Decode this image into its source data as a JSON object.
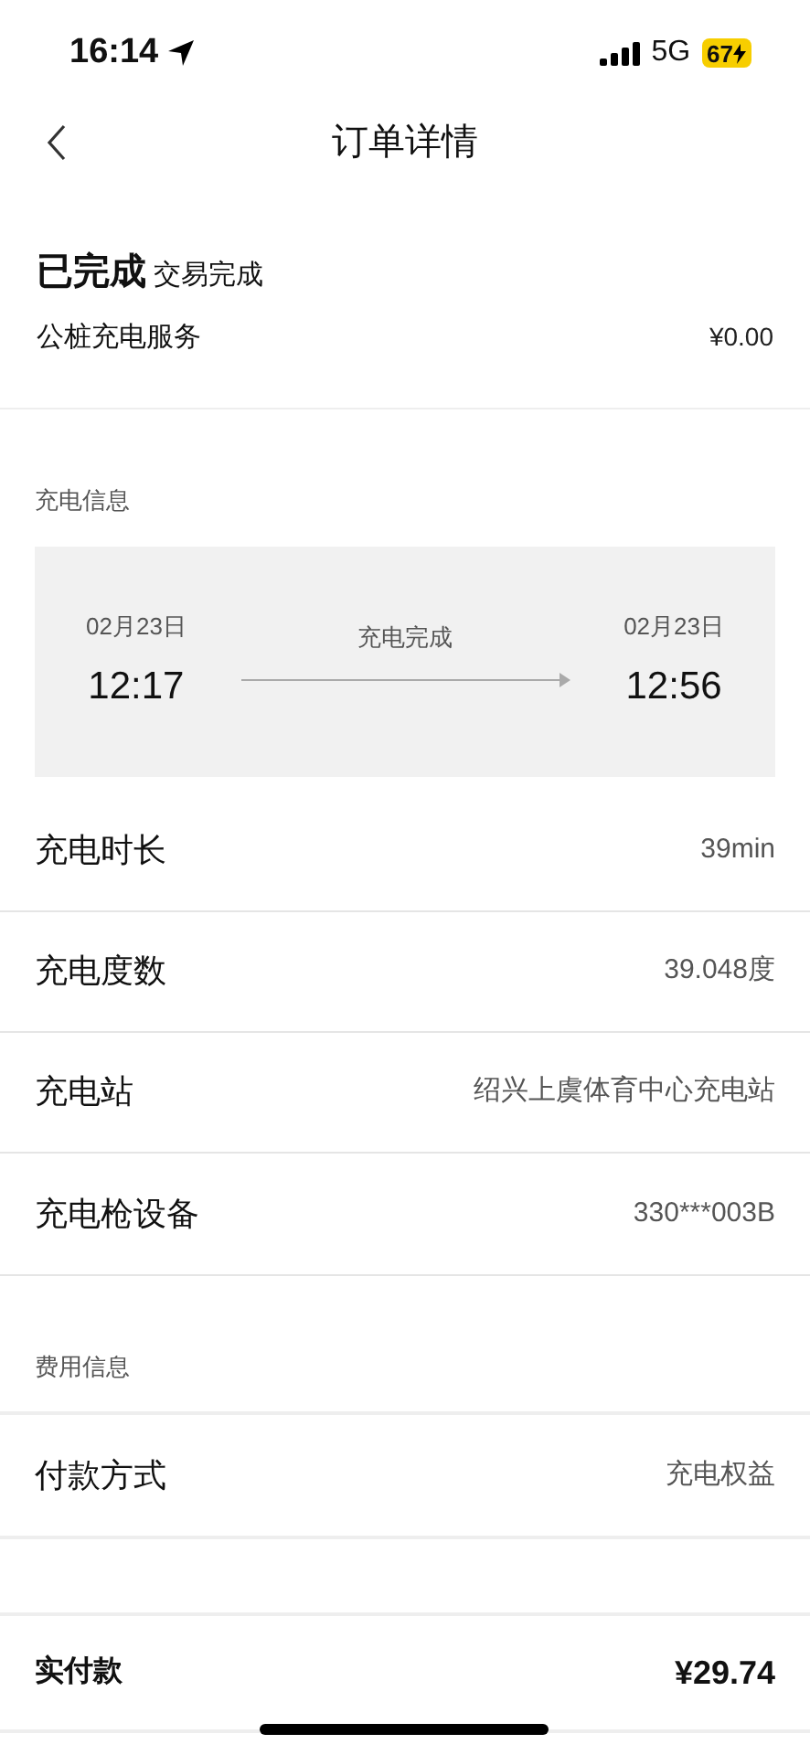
{
  "status_bar": {
    "time": "16:14",
    "network": "5G",
    "battery": "67"
  },
  "nav": {
    "title": "订单详情"
  },
  "order": {
    "status": "已完成",
    "status_detail": "交易完成",
    "service": "公桩充电服务",
    "amount": "¥0.00"
  },
  "charging": {
    "title": "充电信息",
    "start_date": "02月23日",
    "start_time": "12:17",
    "progress_label": "充电完成",
    "end_date": "02月23日",
    "end_time": "12:56",
    "rows": [
      {
        "label": "充电时长",
        "value": "39min"
      },
      {
        "label": "充电度数",
        "value": "39.048度"
      },
      {
        "label": "充电站",
        "value": "绍兴上虞体育中心充电站"
      },
      {
        "label": "充电枪设备",
        "value": "330***003B"
      }
    ]
  },
  "fees": {
    "title": "费用信息",
    "rows": [
      {
        "label": "付款方式",
        "value": "充电权益"
      }
    ]
  },
  "total": {
    "label": "实付款",
    "value": "¥29.74"
  }
}
